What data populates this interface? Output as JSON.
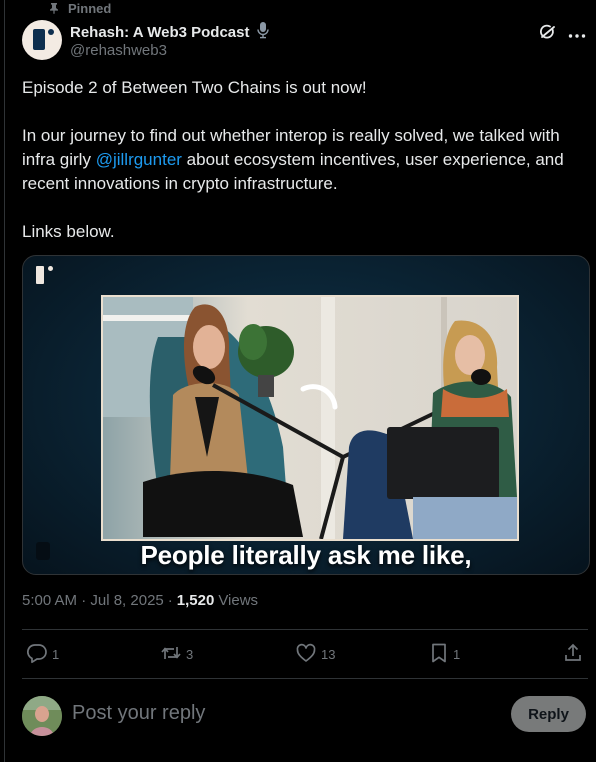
{
  "pinned_label": "Pinned",
  "author": {
    "display_name": "Rehash: A Web3 Podcast",
    "handle": "@rehashweb3",
    "badge_icon": "microphone-icon"
  },
  "tweet": {
    "line1": "Episode 2 of Between Two Chains is out now!",
    "para2_before": "In our journey to find out whether interop is really solved, we talked with infra girly",
    "mention": "@jillrgunter",
    "para2_after": "about ecosystem incentives, user experience, and recent innovations in crypto infrastructure.",
    "line3": "Links below."
  },
  "media": {
    "caption": "People literally ask me like,"
  },
  "meta": {
    "timestamp": "5:00 AM · Jul 8, 2025",
    "separator": "·",
    "views_count": "1,520",
    "views_label": "Views"
  },
  "actions": {
    "replies": "1",
    "reposts": "3",
    "likes": "13",
    "bookmarks": "1"
  },
  "reply_box": {
    "placeholder": "Post your reply",
    "button_label": "Reply"
  },
  "colors": {
    "background": "#000000",
    "text": "#e7e9ea",
    "secondary": "#71767b",
    "accent": "#1d9bf0",
    "divider": "#2f3336"
  }
}
